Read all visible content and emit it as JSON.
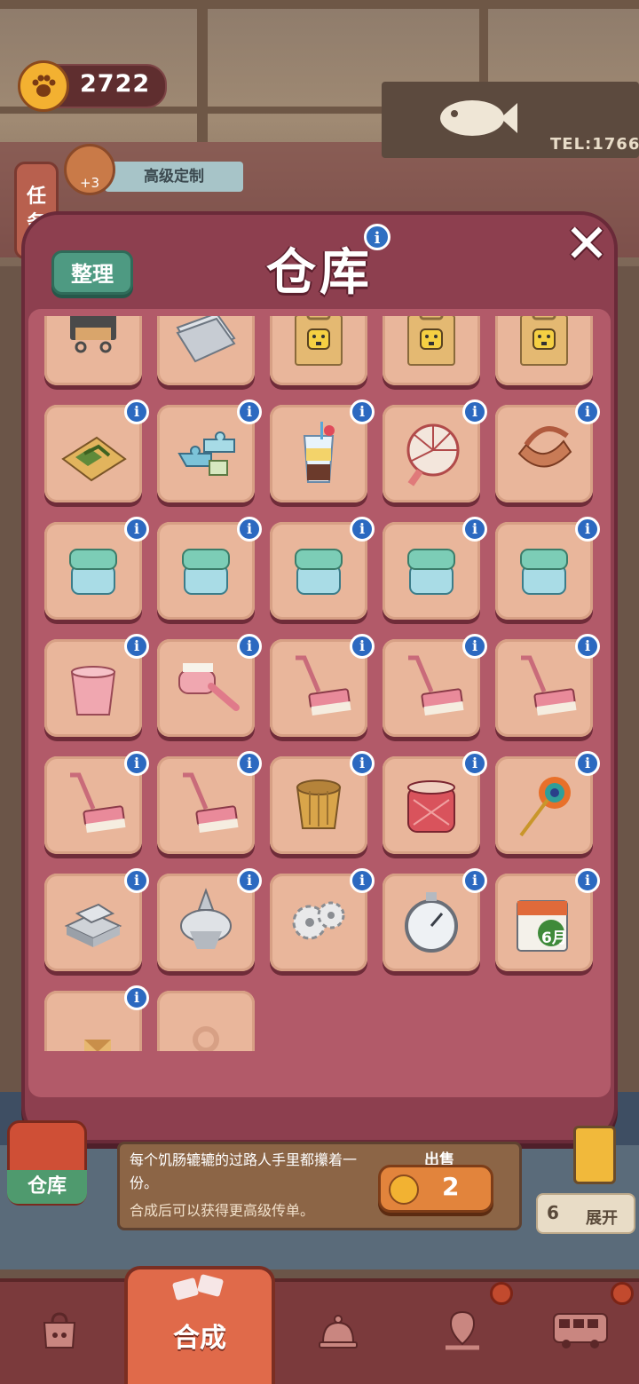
{
  "hud": {
    "coins": "2722",
    "task_label_1": "任",
    "task_label_2": "务",
    "bonus": "+3",
    "premium_tab": "高级定制"
  },
  "dialog": {
    "title": "仓库",
    "sort_label": "整理",
    "info_glyph": "i"
  },
  "items": [
    {
      "name": "wall-hook-icon"
    },
    {
      "name": "paper-stack-icon"
    },
    {
      "name": "socket-box-icon"
    },
    {
      "name": "socket-box-icon"
    },
    {
      "name": "socket-box-icon"
    },
    {
      "name": "herb-tray-icon"
    },
    {
      "name": "puzzle-pieces-icon"
    },
    {
      "name": "bubble-tea-icon"
    },
    {
      "name": "paper-fan-icon"
    },
    {
      "name": "basket-bag-icon"
    },
    {
      "name": "cream-jar-icon"
    },
    {
      "name": "cream-jar-icon"
    },
    {
      "name": "cream-jar-icon"
    },
    {
      "name": "cream-jar-icon"
    },
    {
      "name": "cream-jar-icon"
    },
    {
      "name": "pink-bucket-icon"
    },
    {
      "name": "pink-brush-icon"
    },
    {
      "name": "floor-mop-icon"
    },
    {
      "name": "floor-mop-icon"
    },
    {
      "name": "floor-mop-icon"
    },
    {
      "name": "floor-mop-icon"
    },
    {
      "name": "floor-mop-icon"
    },
    {
      "name": "wooden-cup-icon"
    },
    {
      "name": "red-jar-icon"
    },
    {
      "name": "peacock-feather-icon"
    },
    {
      "name": "silver-bars-icon"
    },
    {
      "name": "silver-bell-icon"
    },
    {
      "name": "gear-parts-icon"
    },
    {
      "name": "stopwatch-icon"
    },
    {
      "name": "calendar-icon"
    },
    {
      "name": "envelope-icon"
    },
    {
      "name": "empty-slot"
    }
  ],
  "calendar_text": "6月",
  "detail": {
    "description_line1": "每个饥肠辘辘的过路人手里都攥着一份。",
    "description_line2": "合成后可以获得更高级传单。",
    "sell_label": "出售",
    "sell_price": "2",
    "warehouse_label": "仓库",
    "expand_count": "6",
    "expand_label": "展开"
  },
  "tabs": {
    "active_label": "合成"
  },
  "shop_sign": "TEL:1766"
}
